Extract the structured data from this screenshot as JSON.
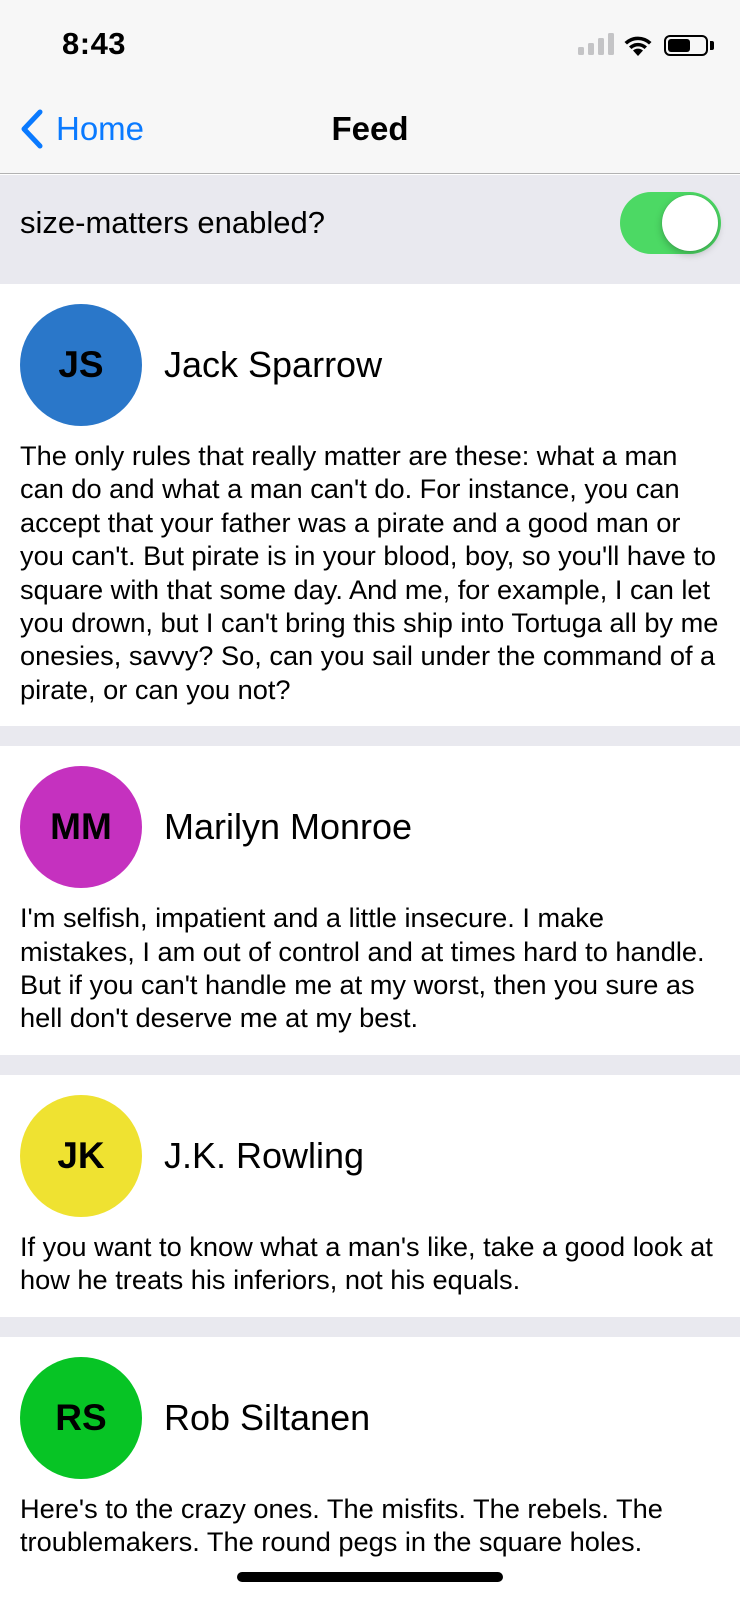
{
  "status_bar": {
    "time": "8:43",
    "icons": [
      "cellular-signal-icon",
      "wifi-icon",
      "battery-icon"
    ],
    "battery_level": 0.6
  },
  "nav": {
    "back_label": "Home",
    "back_icon": "chevron-left-icon",
    "title": "Feed",
    "accent_color": "#0a7aff"
  },
  "settings": {
    "label": "size-matters enabled?",
    "toggle_on": true,
    "toggle_color": "#4cd964"
  },
  "posts": [
    {
      "initials": "JS",
      "name": "Jack Sparrow",
      "avatar_color": "#2a77c9",
      "text": "The only rules that really matter are these: what a man can do and what a man can't do. For instance, you can accept that your father was a pirate and a good man or you can't. But pirate is in your blood, boy, so you'll have to square with that some day. And me, for example, I can let you drown, but I can't bring this ship into Tortuga all by me onesies, savvy? So, can you sail under the command of a pirate, or can you not?"
    },
    {
      "initials": "MM",
      "name": "Marilyn Monroe",
      "avatar_color": "#c531bf",
      "text": "I'm selfish, impatient and a little insecure. I make mistakes, I am out of control and at times hard to handle. But if you can't handle me at my worst, then you sure as hell don't deserve me at my best."
    },
    {
      "initials": "JK",
      "name": "J.K. Rowling",
      "avatar_color": "#efe231",
      "text": "If you want to know what a man's like, take a good look at how he treats his inferiors, not his equals."
    },
    {
      "initials": "RS",
      "name": "Rob Siltanen",
      "avatar_color": "#07c425",
      "text": "Here's to the crazy ones. The misfits. The rebels. The troublemakers. The round pegs in the square holes."
    }
  ]
}
